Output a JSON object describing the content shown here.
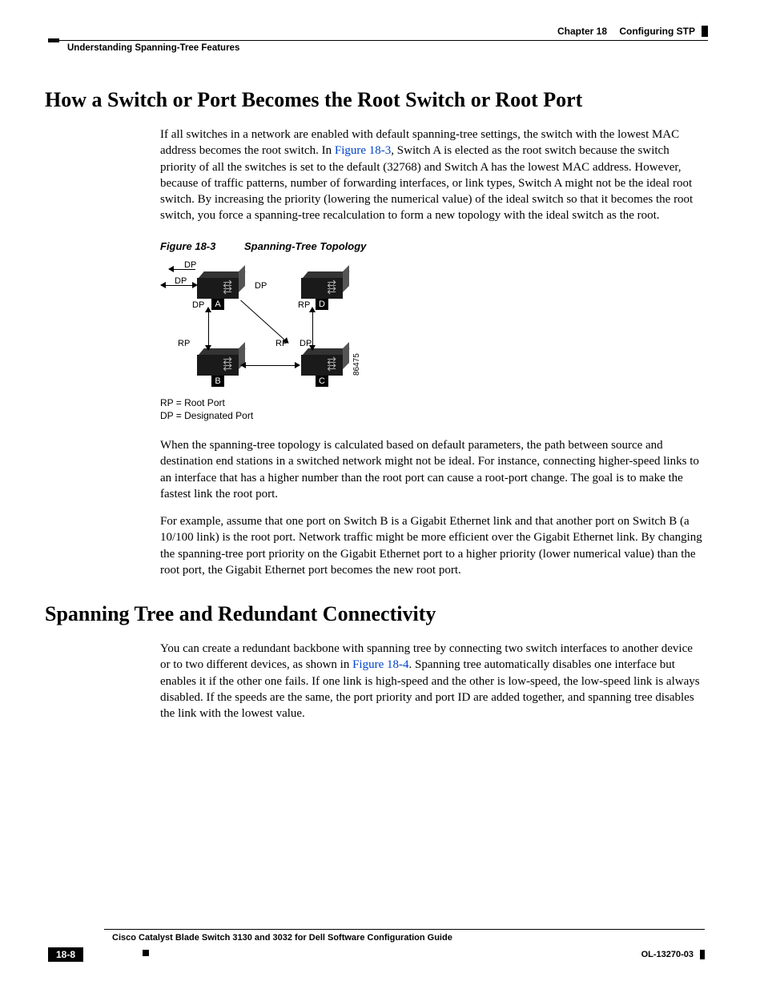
{
  "header": {
    "chapter_label": "Chapter 18",
    "chapter_title": "Configuring STP",
    "section": "Understanding Spanning-Tree Features"
  },
  "h1_a": "How a Switch or Port Becomes the Root Switch or Root Port",
  "p1a": "If all switches in a network are enabled with default spanning-tree settings, the switch with the lowest MAC address becomes the root switch. In ",
  "p1link": "Figure 18-3",
  "p1b": ", Switch A is elected as the root switch because the switch priority of all the switches is set to the default (32768) and Switch A has the lowest MAC address. However, because of traffic patterns, number of forwarding interfaces, or link types, Switch A might not be the ideal root switch. By increasing the priority (lowering the numerical value) of the ideal switch so that it becomes the root switch, you force a spanning-tree recalculation to form a new topology with the ideal switch as the root.",
  "fig_caption_num": "Figure 18-3",
  "fig_caption_title": "Spanning-Tree Topology",
  "diagram": {
    "switches": {
      "A": "A",
      "B": "B",
      "C": "C",
      "D": "D"
    },
    "labels": {
      "DP": "DP",
      "RP": "RP"
    },
    "id_number": "86475",
    "legend1": "RP = Root Port",
    "legend2": "DP = Designated Port"
  },
  "p2": "When the spanning-tree topology is calculated based on default parameters, the path between source and destination end stations in a switched network might not be ideal. For instance, connecting higher-speed links to an interface that has a higher number than the root port can cause a root-port change. The goal is to make the fastest link the root port.",
  "p3": "For example, assume that one port on Switch B is a Gigabit Ethernet link and that another port on Switch B (a 10/100 link) is the root port. Network traffic might be more efficient over the Gigabit Ethernet link. By changing the spanning-tree port priority on the Gigabit Ethernet port to a higher priority (lower numerical value) than the root port, the Gigabit Ethernet port becomes the new root port.",
  "h1_b": "Spanning Tree and Redundant Connectivity",
  "p4a": "You can create a redundant backbone with spanning tree by connecting two switch interfaces to another device or to two different devices, as shown in ",
  "p4link": "Figure 18-4",
  "p4b": ". Spanning tree automatically disables one interface but enables it if the other one fails. If one link is high-speed and the other is low-speed, the low-speed link is always disabled. If the speeds are the same, the port priority and port ID are added together, and spanning tree disables the link with the lowest value.",
  "footer": {
    "book_title": "Cisco Catalyst Blade Switch 3130 and 3032 for Dell Software Configuration Guide",
    "page": "18-8",
    "doc_id": "OL-13270-03"
  }
}
